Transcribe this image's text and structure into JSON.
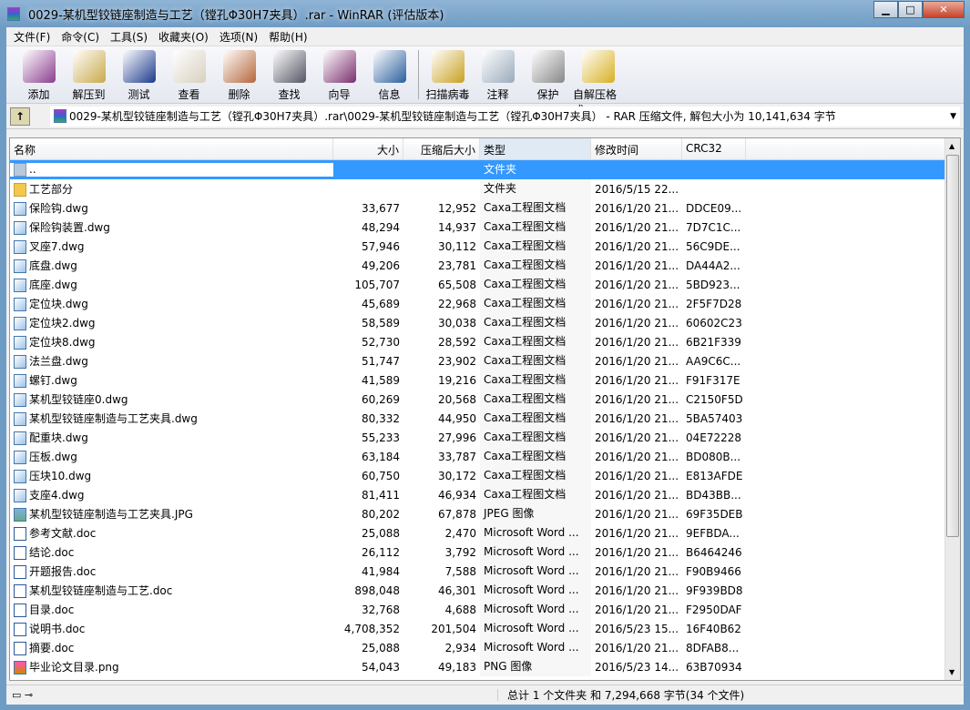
{
  "window": {
    "title": "0029-某机型铰链座制造与工艺（镗孔Φ30H7夹具）.rar - WinRAR (评估版本)"
  },
  "menu": [
    "文件(F)",
    "命令(C)",
    "工具(S)",
    "收藏夹(O)",
    "选项(N)",
    "帮助(H)"
  ],
  "toolbar": [
    {
      "label": "添加",
      "icon": "add-archive-icon",
      "color": "#8a3d8f"
    },
    {
      "label": "解压到",
      "icon": "extract-to-icon",
      "color": "#c9a94a"
    },
    {
      "label": "测试",
      "icon": "test-icon",
      "color": "#1b3a8c"
    },
    {
      "label": "查看",
      "icon": "view-icon",
      "color": "#d8d0c0"
    },
    {
      "label": "删除",
      "icon": "delete-icon",
      "color": "#b5673a"
    },
    {
      "label": "查找",
      "icon": "find-icon",
      "color": "#556"
    },
    {
      "label": "向导",
      "icon": "wizard-icon",
      "color": "#7a2e6e"
    },
    {
      "label": "信息",
      "icon": "info-icon",
      "color": "#2a5f9e"
    },
    {
      "label": "扫描病毒",
      "icon": "virus-scan-icon",
      "color": "#c9a020"
    },
    {
      "label": "注释",
      "icon": "comment-icon",
      "color": "#9ab"
    },
    {
      "label": "保护",
      "icon": "protect-icon",
      "color": "#888"
    },
    {
      "label": "自解压格式",
      "icon": "sfx-icon",
      "color": "#d8b020"
    }
  ],
  "address": "0029-某机型铰链座制造与工艺（镗孔Φ30H7夹具）.rar\\0029-某机型铰链座制造与工艺（镗孔Φ30H7夹具） - RAR 压缩文件, 解包大小为 10,141,634 字节",
  "columns": [
    "名称",
    "大小",
    "压缩后大小",
    "类型",
    "修改时间",
    "CRC32"
  ],
  "files": [
    [
      "..",
      "",
      "",
      "文件夹",
      "",
      "",
      "up"
    ],
    [
      "工艺部分",
      "",
      "",
      "文件夹",
      "2016/5/15 22...",
      "",
      "folder"
    ],
    [
      "保险钩.dwg",
      "33,677",
      "12,952",
      "Caxa工程图文档",
      "2016/1/20 21...",
      "DDCE09...",
      "dwg"
    ],
    [
      "保险钩装置.dwg",
      "48,294",
      "14,937",
      "Caxa工程图文档",
      "2016/1/20 21...",
      "7D7C1C...",
      "dwg"
    ],
    [
      "叉座7.dwg",
      "57,946",
      "30,112",
      "Caxa工程图文档",
      "2016/1/20 21...",
      "56C9DE...",
      "dwg"
    ],
    [
      "底盘.dwg",
      "49,206",
      "23,781",
      "Caxa工程图文档",
      "2016/1/20 21...",
      "DA44A2...",
      "dwg"
    ],
    [
      "底座.dwg",
      "105,707",
      "65,508",
      "Caxa工程图文档",
      "2016/1/20 21...",
      "5BD923...",
      "dwg"
    ],
    [
      "定位块.dwg",
      "45,689",
      "22,968",
      "Caxa工程图文档",
      "2016/1/20 21...",
      "2F5F7D28",
      "dwg"
    ],
    [
      "定位块2.dwg",
      "58,589",
      "30,038",
      "Caxa工程图文档",
      "2016/1/20 21...",
      "60602C23",
      "dwg"
    ],
    [
      "定位块8.dwg",
      "52,730",
      "28,592",
      "Caxa工程图文档",
      "2016/1/20 21...",
      "6B21F339",
      "dwg"
    ],
    [
      "法兰盘.dwg",
      "51,747",
      "23,902",
      "Caxa工程图文档",
      "2016/1/20 21...",
      "AA9C6C...",
      "dwg"
    ],
    [
      "螺钉.dwg",
      "41,589",
      "19,216",
      "Caxa工程图文档",
      "2016/1/20 21...",
      "F91F317E",
      "dwg"
    ],
    [
      "某机型铰链座0.dwg",
      "60,269",
      "20,568",
      "Caxa工程图文档",
      "2016/1/20 21...",
      "C2150F5D",
      "dwg"
    ],
    [
      "某机型铰链座制造与工艺夹具.dwg",
      "80,332",
      "44,950",
      "Caxa工程图文档",
      "2016/1/20 21...",
      "5BA57403",
      "dwg"
    ],
    [
      "配重块.dwg",
      "55,233",
      "27,996",
      "Caxa工程图文档",
      "2016/1/20 21...",
      "04E72228",
      "dwg"
    ],
    [
      "压板.dwg",
      "63,184",
      "33,787",
      "Caxa工程图文档",
      "2016/1/20 21...",
      "BD080B...",
      "dwg"
    ],
    [
      "压块10.dwg",
      "60,750",
      "30,172",
      "Caxa工程图文档",
      "2016/1/20 21...",
      "E813AFDE",
      "dwg"
    ],
    [
      "支座4.dwg",
      "81,411",
      "46,934",
      "Caxa工程图文档",
      "2016/1/20 21...",
      "BD43BB...",
      "dwg"
    ],
    [
      "某机型铰链座制造与工艺夹具.JPG",
      "80,202",
      "67,878",
      "JPEG 图像",
      "2016/1/20 21...",
      "69F35DEB",
      "img"
    ],
    [
      "参考文献.doc",
      "25,088",
      "2,470",
      "Microsoft Word ...",
      "2016/1/20 21...",
      "9EFBDA...",
      "doc"
    ],
    [
      "结论.doc",
      "26,112",
      "3,792",
      "Microsoft Word ...",
      "2016/1/20 21...",
      "B6464246",
      "doc"
    ],
    [
      "开题报告.doc",
      "41,984",
      "7,588",
      "Microsoft Word ...",
      "2016/1/20 21...",
      "F90B9466",
      "doc"
    ],
    [
      "某机型铰链座制造与工艺.doc",
      "898,048",
      "46,301",
      "Microsoft Word ...",
      "2016/1/20 21...",
      "9F939BD8",
      "doc"
    ],
    [
      "目录.doc",
      "32,768",
      "4,688",
      "Microsoft Word ...",
      "2016/1/20 21...",
      "F2950DAF",
      "doc"
    ],
    [
      "说明书.doc",
      "4,708,352",
      "201,504",
      "Microsoft Word ...",
      "2016/5/23 15...",
      "16F40B62",
      "doc"
    ],
    [
      "摘要.doc",
      "25,088",
      "2,934",
      "Microsoft Word ...",
      "2016/1/20 21...",
      "8DFAB8...",
      "doc"
    ],
    [
      "毕业论文目录.png",
      "54,043",
      "49,183",
      "PNG 图像",
      "2016/5/23 14...",
      "63B70934",
      "png"
    ]
  ],
  "status": "总计 1 个文件夹 和 7,294,668 字节(34 个文件)"
}
